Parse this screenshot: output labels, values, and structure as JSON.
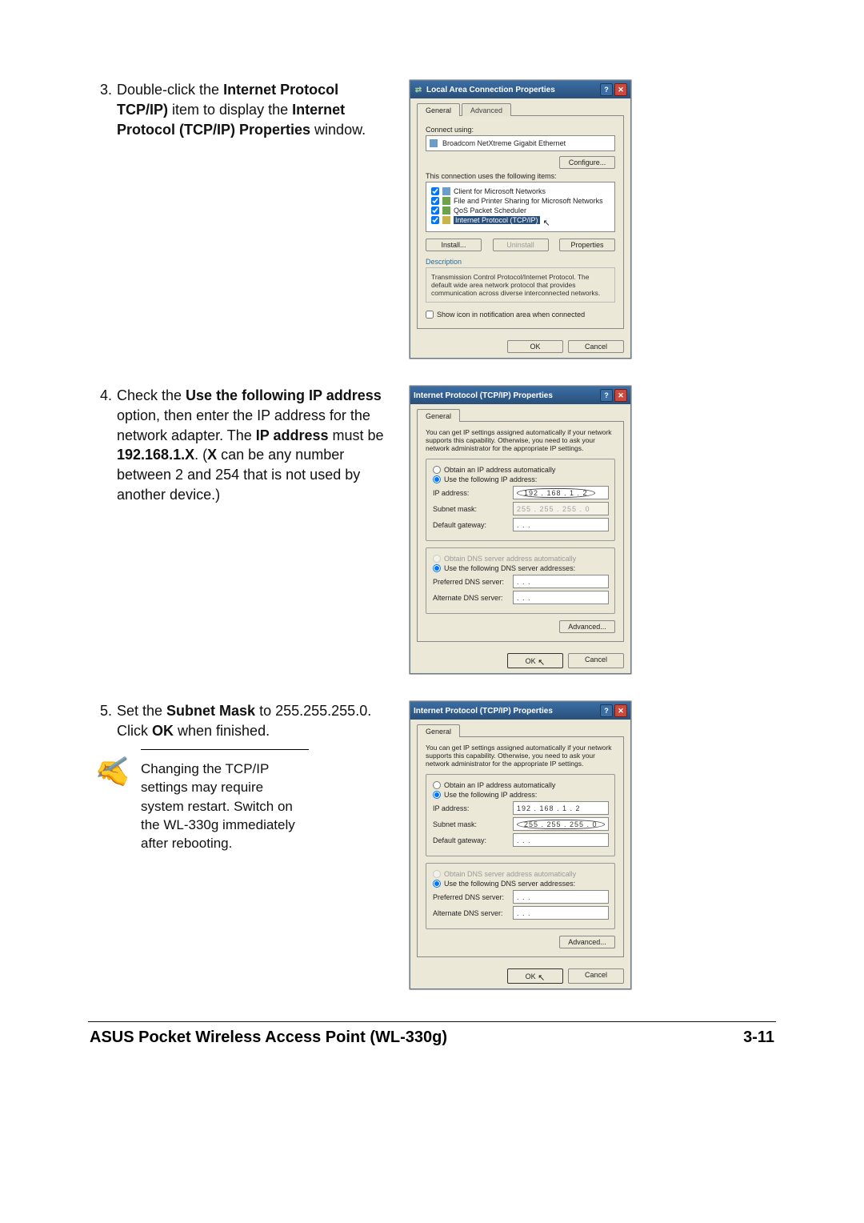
{
  "step3": {
    "num": "3.",
    "text_pre": "Double-click the ",
    "b1": "Internet Protocol TCP/IP)",
    "mid1": " item to display the ",
    "b2": "Internet Protocol (TCP/IP) Properties",
    "mid2": " window."
  },
  "step4": {
    "num": "4.",
    "text_pre": "Check the ",
    "b1": "Use the following IP address",
    "mid1": " option, then enter the IP address for the network adapter. The ",
    "b2": "IP address",
    "mid2": " must be ",
    "b3": "192.168.1.X",
    "mid3": ". (",
    "b4": "X",
    "mid4": " can be any number between 2 and 254 that is not used by another device.)"
  },
  "step5": {
    "num": "5.",
    "text_pre": "Set the ",
    "b1": "Subnet Mask",
    "mid1": " to 255.255.255.0. Click ",
    "b2": "OK",
    "mid2": " when finished."
  },
  "note": "Changing the TCP/IP settings may require system restart. Switch on the WL-330g  immediately after rebooting.",
  "dlg1": {
    "title": "Local Area Connection Properties",
    "tab1": "General",
    "tab2": "Advanced",
    "connect_using": "Connect using:",
    "adapter": "Broadcom NetXtreme Gigabit Ethernet",
    "configure": "Configure...",
    "uses": "This connection uses the following items:",
    "it1": "Client for Microsoft Networks",
    "it2": "File and Printer Sharing for Microsoft Networks",
    "it3": "QoS Packet Scheduler",
    "it4": "Internet Protocol (TCP/IP)",
    "install": "Install...",
    "uninstall": "Uninstall",
    "properties": "Properties",
    "desc_lbl": "Description",
    "desc": "Transmission Control Protocol/Internet Protocol. The default wide area network protocol that provides communication across diverse interconnected networks.",
    "show": "Show icon in notification area when connected",
    "ok": "OK",
    "cancel": "Cancel"
  },
  "dlg2": {
    "title": "Internet Protocol (TCP/IP) Properties",
    "tab": "General",
    "intro": "You can get IP settings assigned automatically if your network supports this capability. Otherwise, you need to ask your network administrator for the appropriate IP settings.",
    "r1": "Obtain an IP address automatically",
    "r2": "Use the following IP address:",
    "ip": "IP address:",
    "ip_v": "192 . 168 .  1  .  2",
    "sm": "Subnet mask:",
    "sm_v": "255 . 255 . 255 .  0",
    "gw": "Default gateway:",
    "gw_v": " .     .     . ",
    "r3": "Obtain DNS server address automatically",
    "r4": "Use the following DNS server addresses:",
    "p": "Preferred DNS server:",
    "a": "Alternate DNS server:",
    "adv": "Advanced...",
    "ok": "OK",
    "cancel": "Cancel"
  },
  "footer": {
    "title": "ASUS Pocket Wireless Access Point (WL-330g)",
    "page": "3-11"
  }
}
